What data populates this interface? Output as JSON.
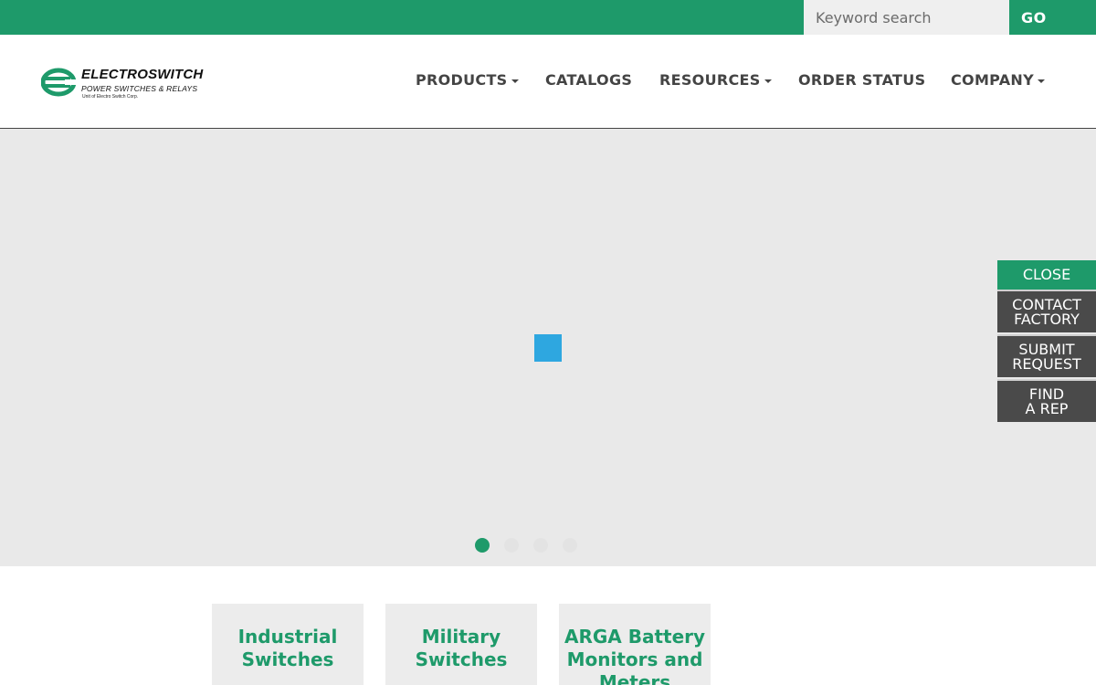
{
  "search": {
    "placeholder": "Keyword search",
    "go_label": "GO"
  },
  "logo": {
    "name": "ELECTROSWITCH",
    "tagline": "POWER SWITCHES & RELAYS",
    "sub": "Unit of Electro Switch Corp."
  },
  "nav": {
    "products": "PRODUCTS",
    "catalogs": "CATALOGS",
    "resources": "RESOURCES",
    "order_status": "ORDER STATUS",
    "company": "COMPANY"
  },
  "side_menu": {
    "close": "CLOSE",
    "contact_line1": "CONTACT",
    "contact_line2": "FACTORY",
    "submit_line1": "SUBMIT",
    "submit_line2": "REQUEST",
    "find_line1": "FIND",
    "find_line2": "A REP"
  },
  "slider": {
    "slide_count": 4,
    "active_slide": 1
  },
  "cards": [
    {
      "line1": "Industrial",
      "line2": "Switches",
      "line3": ""
    },
    {
      "line1": "Military",
      "line2": "Switches",
      "line3": ""
    },
    {
      "line1": "ARGA Battery",
      "line2": "Monitors and",
      "line3": "Meters"
    }
  ],
  "colors": {
    "brand_green": "#1e9a6a",
    "loader_blue": "#2ea7e0",
    "side_dark": "#4a4a4a",
    "hero_bg": "#e9e9e9"
  }
}
